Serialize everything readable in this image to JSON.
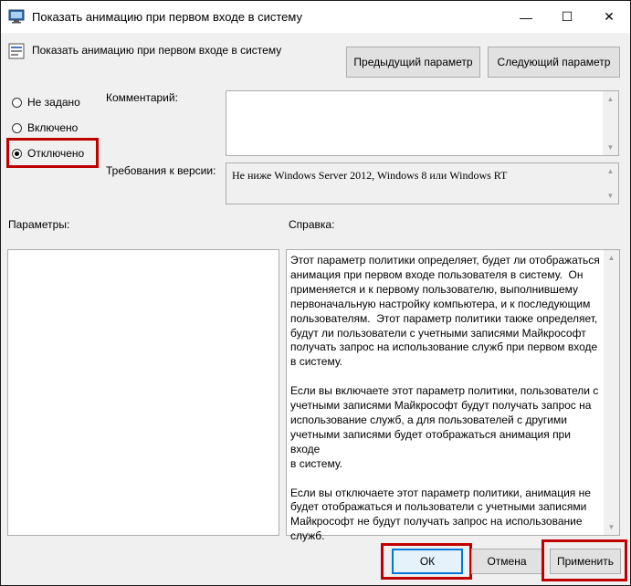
{
  "window": {
    "title": "Показать анимацию при первом входе в систему",
    "minimize_glyph": "—",
    "maximize_glyph": "☐",
    "close_glyph": "✕"
  },
  "header": {
    "policy_title": "Показать анимацию при первом входе в систему",
    "prev_button": "Предыдущий параметр",
    "next_button": "Следующий параметр"
  },
  "state": {
    "options": [
      {
        "label": "Не задано",
        "checked": false
      },
      {
        "label": "Включено",
        "checked": false
      },
      {
        "label": "Отключено",
        "checked": true
      }
    ]
  },
  "comment": {
    "label": "Комментарий:",
    "value": ""
  },
  "requirements": {
    "label": "Требования к версии:",
    "value": "Не ниже Windows Server 2012, Windows 8 или Windows RT"
  },
  "options_panel": {
    "label": "Параметры:"
  },
  "help_panel": {
    "label": "Справка:",
    "text": "Этот параметр политики определяет, будет ли отображаться\nанимация при первом входе пользователя в систему.  Он\nприменяется и к первому пользователю, выполнившему\nпервоначальную настройку компьютера, и к последующим\nпользователям.  Этот параметр политики также определяет,\nбудут ли пользователи с учетными записями Майкрософт\nполучать запрос на использование служб при первом входе\nв систему.\n\nЕсли вы включаете этот параметр политики, пользователи с\nучетными записями Майкрософт будут получать запрос на\nиспользование служб, а для пользователей с другими\nучетными записями будет отображаться анимация при входе\nв систему.\n\nЕсли вы отключаете этот параметр политики, анимация не\nбудет отображаться и пользователи с учетными записями\nМайкрософт не будут получать запрос на использование\nслужб."
  },
  "footer": {
    "ok": "ОК",
    "cancel": "Отмена",
    "apply": "Применить"
  },
  "colors": {
    "highlight": "#c00000",
    "window_bg": "#f0f0f0"
  }
}
